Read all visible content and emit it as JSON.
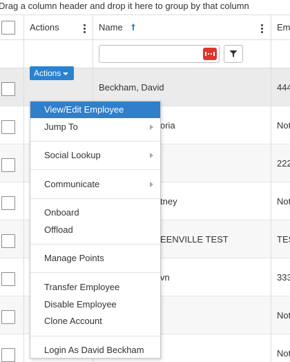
{
  "group_bar": {
    "text": "Drag a column header and drop it here to group by that column"
  },
  "header": {
    "actions_label": "Actions",
    "name_label": "Name",
    "emp_label": "Em"
  },
  "icons": {
    "sort": "sort-ascending-icon",
    "kebab": "kebab-menu-icon",
    "filter": "filter-funnel-icon",
    "clear": "clear-filter-icon",
    "submenu": "chevron-right-icon",
    "caret": "caret-down-icon"
  },
  "colors": {
    "accent": "#2a82d0",
    "menu_active": "#2f7fcb",
    "clear_button": "#e0342c",
    "sort_arrow": "#2a8dd4"
  },
  "rows": [
    {
      "name": "Beckham, David",
      "emp": "444"
    },
    {
      "name": "oria",
      "emp": "Not"
    },
    {
      "name": "",
      "emp": "222"
    },
    {
      "name": "tney",
      "emp": "Not"
    },
    {
      "name": "EENVILLE TEST",
      "emp": "TES"
    },
    {
      "name": "vn",
      "emp": "333"
    },
    {
      "name": "",
      "emp": "Not"
    },
    {
      "name": "",
      "emp": "Not"
    }
  ],
  "actions_button": {
    "label": "Actions"
  },
  "menu": {
    "view_edit": "View/Edit Employee",
    "jump_to": "Jump To",
    "social_lookup": "Social Lookup",
    "communicate": "Communicate",
    "onboard": "Onboard",
    "offload": "Offload",
    "manage_points": "Manage Points",
    "transfer": "Transfer Employee",
    "disable": "Disable Employee",
    "clone": "Clone Account",
    "login_as": "Login As David Beckham"
  }
}
